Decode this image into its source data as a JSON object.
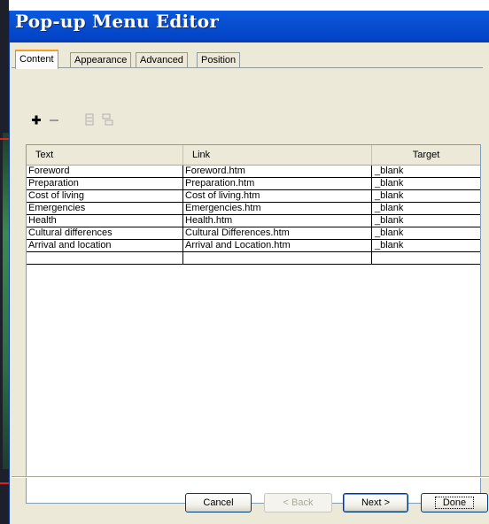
{
  "window": {
    "title": "Pop-up Menu Editor"
  },
  "tabs": [
    {
      "label": "Content",
      "active": true
    },
    {
      "label": "Appearance",
      "active": false
    },
    {
      "label": "Advanced",
      "active": false
    },
    {
      "label": "Position",
      "active": false
    }
  ],
  "toolbar": {
    "add_icon": "plus-icon",
    "remove_icon": "minus-icon",
    "move_up_icon": "indent-icon",
    "move_down_icon": "outdent-icon"
  },
  "table": {
    "headers": [
      "Text",
      "Link",
      "Target"
    ],
    "rows": [
      [
        "Foreword",
        "Foreword.htm",
        "_blank"
      ],
      [
        "Preparation",
        "Preparation.htm",
        "_blank"
      ],
      [
        "Cost of living",
        "Cost of living.htm",
        "_blank"
      ],
      [
        "Emergencies",
        "Emergencies.htm",
        "_blank"
      ],
      [
        "Health",
        "Health.htm",
        "_blank"
      ],
      [
        "Cultural differences",
        "Cultural Differences.htm",
        "_blank"
      ],
      [
        "Arrival and location",
        "Arrival and Location.htm",
        "_blank"
      ],
      [
        "",
        "",
        ""
      ]
    ]
  },
  "buttons": {
    "cancel": "Cancel",
    "back": "< Back",
    "next": "Next >",
    "done": "Done"
  },
  "colors": {
    "titlebar": "#0a4fd0",
    "active_tab_accent": "#ff9a1a",
    "dialog_bg": "#ece9d8"
  }
}
